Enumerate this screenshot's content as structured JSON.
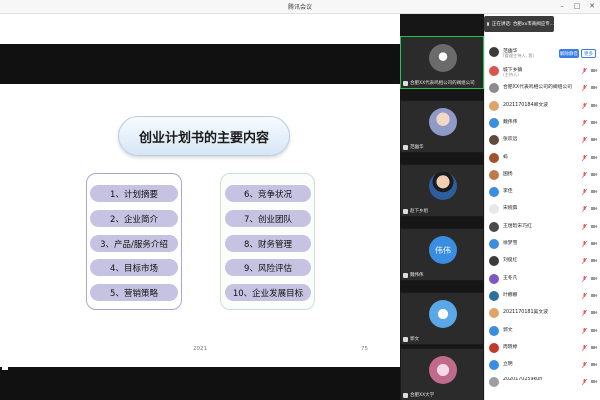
{
  "window": {
    "title": "腾讯会议"
  },
  "notification": {
    "text": "正在讲话: 合肥xx市商阀应专..."
  },
  "slide": {
    "title": "创业计划书的主要内容",
    "left_items": [
      "1、计划摘要",
      "2、企业简介",
      "3、产品/服务介绍",
      "4、目标市场",
      "5、营销策略"
    ],
    "right_items": [
      "6、竞争状况",
      "7、创业团队",
      "8、财务管理",
      "9、风险评估",
      "10、企业发展目标"
    ],
    "year": "2021",
    "page_number": "75"
  },
  "video_tiles": [
    {
      "label": "合肥XX代表鸣相公司的阀组公司",
      "avatar": ""
    },
    {
      "label": "范幽华",
      "avatar": ""
    },
    {
      "label": "赵下乡组",
      "avatar": ""
    },
    {
      "label": "魏伟伟",
      "avatar": "伟伟"
    },
    {
      "label": "郭文",
      "avatar": ""
    },
    {
      "label": "合肥XX大学",
      "avatar": ""
    }
  ],
  "participants_panel": {
    "host": {
      "name": "范幽华",
      "role": "(管理主持人, 我)"
    },
    "mute_button": "解除静音",
    "more_button": "更多",
    "list": [
      {
        "name": "城下乡镇",
        "sub": "(主持人)",
        "color": "#d9534f"
      },
      {
        "name": "合肥XX代表鸣相公司的阀组公司",
        "sub": "",
        "color": "#8c8c8c"
      },
      {
        "name": "2021170184郑文波",
        "sub": "",
        "color": "#e0a36a"
      },
      {
        "name": "魏伟伟",
        "sub": "",
        "color": "#3a8de0"
      },
      {
        "name": "张欢远",
        "sub": "",
        "color": "#5c4a3c"
      },
      {
        "name": "蚂",
        "sub": "",
        "color": "#a0522d"
      },
      {
        "name": "国扬",
        "sub": "",
        "color": "#c07a4a"
      },
      {
        "name": "李佳",
        "sub": "",
        "color": "#3a8de0"
      },
      {
        "name": "宋婉茹",
        "sub": "",
        "color": "#e8e8e8"
      },
      {
        "name": "王煜晗宋巧红",
        "sub": "",
        "color": "#4a4a4a"
      },
      {
        "name": "徐梦雪",
        "sub": "",
        "color": "#3a8de0"
      },
      {
        "name": "刘俊红",
        "sub": "",
        "color": "#3a3a3a"
      },
      {
        "name": "王冬凡",
        "sub": "",
        "color": "#7e57c2"
      },
      {
        "name": "叶娜娜",
        "sub": "",
        "color": "#2f6f9f"
      },
      {
        "name": "2021170181吴文波",
        "sub": "",
        "color": "#e0a36a"
      },
      {
        "name": "郭文",
        "sub": "",
        "color": "#3a8de0"
      },
      {
        "name": "周晓婷",
        "sub": "",
        "color": "#c0392b"
      },
      {
        "name": "立明",
        "sub": "",
        "color": "#3a8de0"
      },
      {
        "name": "2020170259kun",
        "sub": "",
        "color": "#9e9e9e"
      }
    ]
  }
}
